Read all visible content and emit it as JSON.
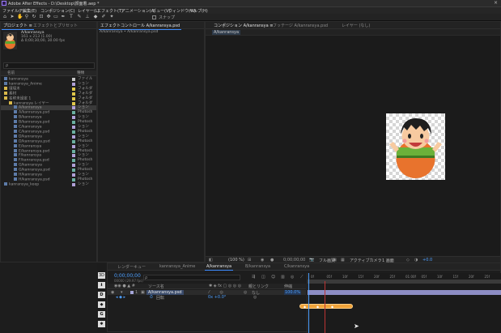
{
  "app": {
    "title": "Adobe After Effects - D:\\Desktop\\顔面着.aep *"
  },
  "menu": [
    "ファイル(F)",
    "編集(E)",
    "コンポジション(C)",
    "レイヤー(L)",
    "エフェクト(T)",
    "アニメーション(A)",
    "ビュー(V)",
    "ウィンドウ(W)",
    "ヘルプ(H)"
  ],
  "toolbar": {
    "snap_label": "スナップ"
  },
  "project": {
    "tab_project": "プロジェクト ≡",
    "tab_effects": "エフェクトとプリセット",
    "item_name": "A/kanransya",
    "item_info1": "161 x 213 (1.00)",
    "item_info2": "Δ 0;00;30;00, 30.00 fps",
    "search_placeholder": "ρ",
    "col_name": "名前",
    "col_type": "種類",
    "rows": [
      {
        "name": "kanransya",
        "type": "ファイル"
      },
      {
        "name": "kanransya_Anime",
        "type": "ション"
      },
      {
        "name": "環境木",
        "type": "フォルダ"
      },
      {
        "name": "素材",
        "type": "フォルダ"
      },
      {
        "name": "名称未設定 1",
        "type": "フォルダ"
      },
      {
        "name": "kanransya レイヤー",
        "type": "フォルダ"
      },
      {
        "name": "A/kanransya",
        "type": "ション"
      },
      {
        "name": "A/kanransya.psd",
        "type": "Photosh"
      },
      {
        "name": "B/kanransya",
        "type": "ション"
      },
      {
        "name": "B/kanransya.psd",
        "type": "Photosh"
      },
      {
        "name": "C/kanransya",
        "type": "ション"
      },
      {
        "name": "C/kanransya.psd",
        "type": "Photosh"
      },
      {
        "name": "D/kanransya",
        "type": "ション"
      },
      {
        "name": "D/kanransya.psd",
        "type": "Photosh"
      },
      {
        "name": "E/kanransya",
        "type": "ション"
      },
      {
        "name": "E/kanransya.psd",
        "type": "Photosh"
      },
      {
        "name": "F/kanransya",
        "type": "ション"
      },
      {
        "name": "F/kanransya.psd",
        "type": "Photosh"
      },
      {
        "name": "G/kanransya",
        "type": "ション"
      },
      {
        "name": "G/kanransya.psd",
        "type": "Photosh"
      },
      {
        "name": "H/kanransya",
        "type": "ション"
      },
      {
        "name": "H/kanransya.psd",
        "type": "Photosh"
      },
      {
        "name": "kanransya_keep",
        "type": "ション"
      }
    ]
  },
  "effect_controls": {
    "tab": "エフェクトコントロール A/kanransya.psd",
    "sub": "A/kanransya • A/kanransya.psd"
  },
  "comp": {
    "tab": "コンポジション A/kanransya ≡",
    "tab_footage": "フッテージ A/kanransya.psd",
    "tab_layer": "レイヤー (なし)",
    "breadcrumb": "A/kanransya",
    "zoom": "(100 %)",
    "timecode": "0;00;00;00",
    "quality": "フル画質",
    "camera": "アクティブカメラ",
    "view": "1 画面",
    "offset": "+0.0"
  },
  "timeline": {
    "tabs": [
      "レンダーキュー",
      "kanransya_Anime",
      "A/kanransya",
      "B/kanransya",
      "C/kanransya"
    ],
    "timecode": "0;00;00;00",
    "frame_info": "00000 (29.97 fps)",
    "col_source": "ソース名",
    "col_parent": "親とリンク",
    "col_stretch": "伸縮",
    "layer1_num": "1",
    "layer1_name": "A/kanransya.psd",
    "layer1_parent": "なし",
    "layer1_stretch": "100.0%",
    "prop_name": "回転",
    "prop_value": "0x +0.0°",
    "ruler": [
      "0f",
      "05f",
      "10f",
      "15f",
      "20f",
      "25f",
      "01:00f",
      "05f",
      "10f",
      "15f",
      "20f",
      "25f"
    ]
  }
}
